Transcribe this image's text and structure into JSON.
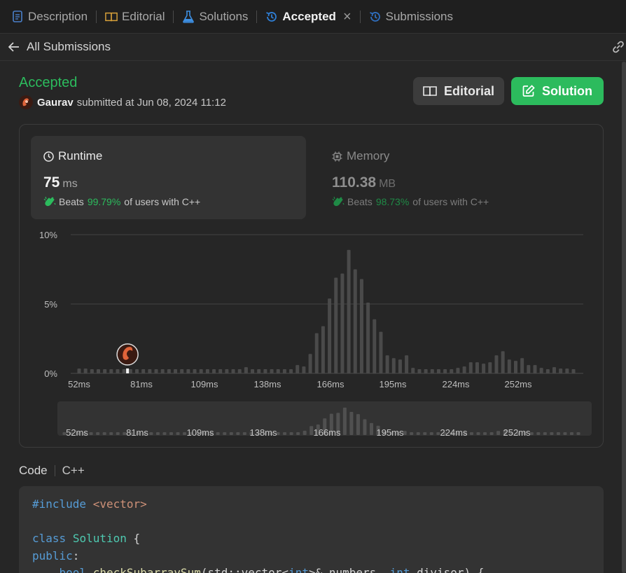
{
  "tabs": [
    {
      "label": "Description",
      "icon": "description-icon",
      "active": false
    },
    {
      "label": "Editorial",
      "icon": "book-icon",
      "active": false
    },
    {
      "label": "Solutions",
      "icon": "flask-icon",
      "active": false
    },
    {
      "label": "Accepted",
      "icon": "history-icon",
      "active": true
    },
    {
      "label": "Submissions",
      "icon": "history-icon",
      "active": false
    }
  ],
  "subheader": {
    "back_label": "All Submissions"
  },
  "submission": {
    "status": "Accepted",
    "author": "Gaurav",
    "submitted_text": "submitted at Jun 08, 2024 11:12"
  },
  "actions": {
    "editorial_label": "Editorial",
    "solution_label": "Solution"
  },
  "runtime": {
    "title": "Runtime",
    "value": "75",
    "unit": "ms",
    "beats_prefix": "Beats",
    "beats_pct": "99.79%",
    "beats_suffix": "of users with C++"
  },
  "memory": {
    "title": "Memory",
    "value": "110.38",
    "unit": "MB",
    "beats_prefix": "Beats",
    "beats_pct": "98.73%",
    "beats_suffix": "of users with C++"
  },
  "colors": {
    "accent": "#2cbb5d",
    "active_tab_icon": "#2f7fd6",
    "bar": "#4a4a4a",
    "bar_mini": "#505050"
  },
  "chart_data": {
    "type": "bar",
    "x_ticks": [
      "52ms",
      "81ms",
      "109ms",
      "138ms",
      "166ms",
      "195ms",
      "224ms",
      "252ms"
    ],
    "y_ticks": [
      "10%",
      "5%",
      "0%"
    ],
    "ylim": [
      0,
      10
    ],
    "grid": true,
    "marker_value_ms": 75,
    "values": [
      0.3,
      0.3,
      0.3,
      0.3,
      0.3,
      0.3,
      0.3,
      0.3,
      0.3,
      0.3,
      0.3,
      0.3,
      0.3,
      0.3,
      0.3,
      0.3,
      0.3,
      0.3,
      0.3,
      0.3,
      0.3,
      0.3,
      0.3,
      0.3,
      0.3,
      0.3,
      0.3,
      0.3,
      0.3,
      0.3,
      0.3,
      0.3,
      0.3,
      0.3,
      0.3,
      0.3,
      0.3,
      0.3,
      0.3,
      0.3,
      0.3,
      0.3,
      0.3,
      0.3,
      0.3,
      0.3,
      0.3,
      0.3,
      0.3,
      0.3,
      0.3,
      0.3,
      0.3,
      0.3,
      0.3,
      0.3,
      0.3,
      0.3,
      0.3,
      0.3,
      0.3,
      0.3,
      0.3,
      0.3,
      0.3,
      0.3,
      0.3,
      0.3,
      0.3,
      0.3,
      0.3,
      0.3,
      0.3,
      0.3,
      0.3,
      0.3,
      0.3,
      0.3,
      0.3,
      0.3,
      0.3,
      0.3,
      0.3,
      0.3,
      0.3,
      0.3,
      0.3,
      0.3,
      0.3,
      0.3,
      0.3,
      0.3,
      0.3,
      0.3,
      0.3,
      0.3,
      0.3,
      0.3,
      0.3,
      0.3,
      0.3,
      0.3,
      0.3,
      0.3,
      0.3,
      0.3,
      0.3,
      0.3,
      0.3,
      0.3,
      0.3,
      0.3,
      0.3,
      0.3,
      0.3,
      0.3,
      0.3,
      0.3,
      0.3,
      0.3,
      0.3,
      0.3,
      0.3,
      0.3,
      0.3,
      0.3,
      0.3,
      0.3,
      0.3,
      0.3,
      0.3,
      0.3,
      0.3,
      0.3,
      0.3,
      0.3,
      0.3,
      0.3,
      0.3,
      0.3,
      0.3,
      0.3,
      0.3,
      0.3,
      0.3,
      0.3,
      0.3,
      0.3,
      0.3,
      0.3,
      0.3,
      0.3,
      0.3,
      0.3,
      0.3,
      0.3,
      0.3,
      0.3,
      0.3,
      0.3,
      0.3,
      0.3,
      0.3,
      0.3,
      0.3,
      0.3,
      0.3,
      0.3,
      0.3,
      0.3,
      0.3,
      0.3,
      0.3,
      0.3,
      0.3,
      0.3,
      0.3,
      0.3,
      0.3,
      0.3,
      0.3,
      0.3,
      0.3,
      0.3,
      0.3,
      0.3,
      0.3,
      0.3,
      0.3,
      0.3,
      0.3,
      0.3,
      0.3,
      0.3
    ],
    "series": [
      {
        "values": [
          0.35,
          0.35,
          0.3,
          0.3,
          0.3,
          0.3,
          0.3,
          0.3,
          0.3,
          0.3,
          0.3,
          0.3,
          0.3,
          0.3,
          0.3,
          0.3,
          0.3,
          0.3,
          0.3,
          0.3,
          0.3,
          0.3,
          0.3,
          0.3,
          0.3,
          0.3,
          0.45,
          0.3,
          0.3,
          0.3,
          0.3,
          0.3,
          0.3,
          0.3,
          0.6,
          0.5,
          1.4,
          2.9,
          3.4,
          5.4,
          6.9,
          7.2,
          8.9,
          7.5,
          6.8,
          5.1,
          3.9,
          3.0,
          1.3,
          1.1,
          1.0,
          1.3,
          0.4,
          0.3,
          0.3,
          0.3,
          0.3,
          0.3,
          0.3,
          0.4,
          0.5,
          0.8,
          0.8,
          0.7,
          0.8,
          1.3,
          1.6,
          1.0,
          0.9,
          1.1,
          0.6,
          0.6,
          0.4,
          0.3,
          0.45,
          0.35,
          0.35,
          0.3
        ]
      }
    ]
  },
  "code": {
    "label": "Code",
    "language": "C++",
    "lines": [
      [
        [
          "c-kw",
          "#include"
        ],
        [
          "c-pl",
          " "
        ],
        [
          "c-str",
          "<vector>"
        ]
      ],
      [],
      [
        [
          "c-kw",
          "class"
        ],
        [
          "c-pl",
          " "
        ],
        [
          "c-type",
          "Solution"
        ],
        [
          "c-pl",
          " {"
        ]
      ],
      [
        [
          "c-kw",
          "public"
        ],
        [
          "c-pl",
          ":"
        ]
      ],
      [
        [
          "c-pl",
          "    "
        ],
        [
          "c-kw",
          "bool"
        ],
        [
          "c-pl",
          " "
        ],
        [
          "c-fn",
          "checkSubarraySum"
        ],
        [
          "c-pl",
          "(std::vector<"
        ],
        [
          "c-kw",
          "int"
        ],
        [
          "c-pl",
          ">& numbers, "
        ],
        [
          "c-kw",
          "int"
        ],
        [
          "c-pl",
          " divisor) {"
        ]
      ]
    ]
  }
}
